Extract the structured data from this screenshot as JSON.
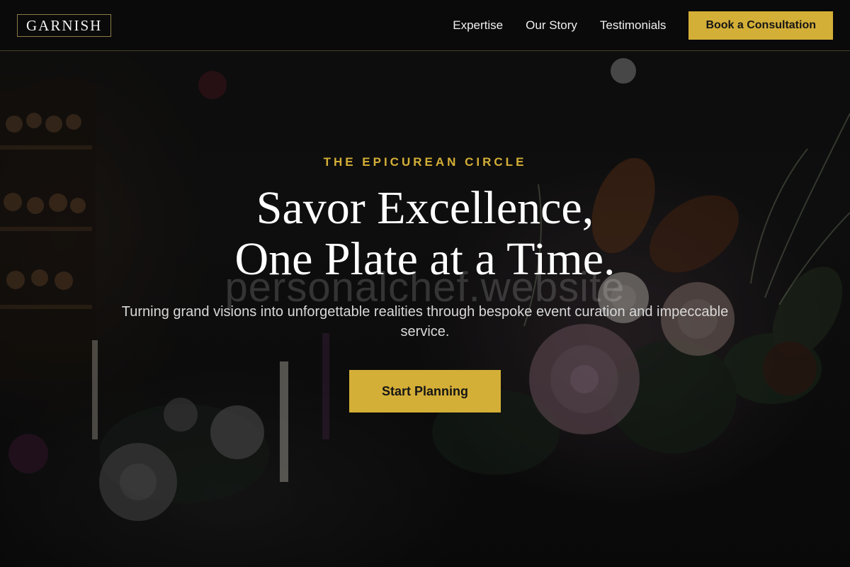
{
  "header": {
    "logo_text": "GARNISH",
    "nav": [
      {
        "label": "Expertise"
      },
      {
        "label": "Our Story"
      },
      {
        "label": "Testimonials"
      }
    ],
    "cta_label": "Book a Consultation"
  },
  "hero": {
    "eyebrow": "THE EPICUREAN CIRCLE",
    "headline_line1": "Savor Excellence,",
    "headline_line2": "One Plate at a Time.",
    "watermark": "personalchef.website",
    "subtitle": "Turning grand visions into unforgettable realities through bespoke event curation and impeccable service.",
    "cta_label": "Start Planning",
    "background_icon": "floral-arrangement-image"
  },
  "colors": {
    "accent": "#d4af37",
    "background": "#0b0b0b",
    "text": "#ffffff",
    "subtext": "#d8d8d8"
  }
}
